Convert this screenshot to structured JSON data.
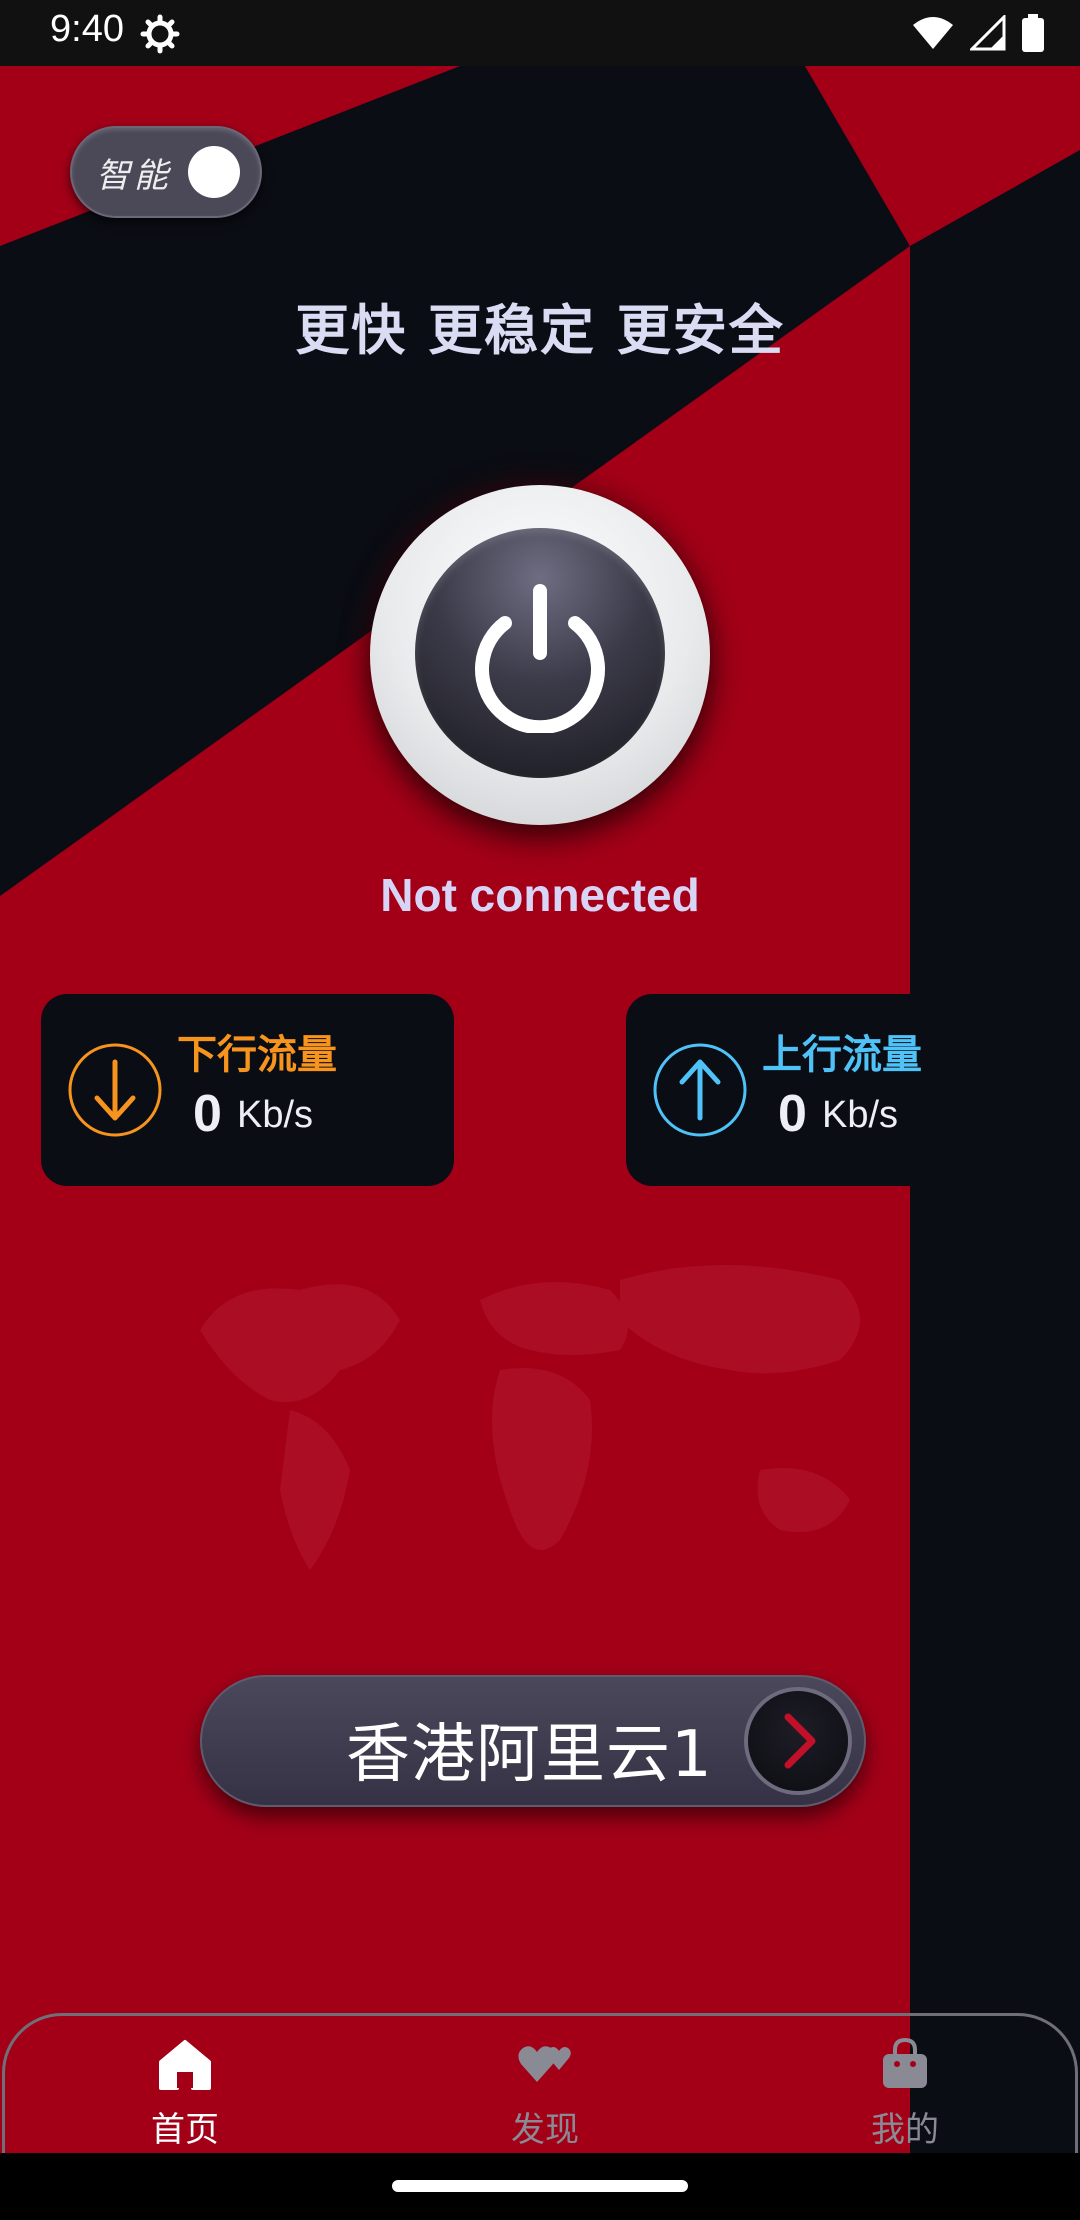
{
  "status_bar": {
    "time": "9:40",
    "icons": [
      "gear-icon",
      "wifi-icon",
      "signal-icon",
      "battery-icon"
    ]
  },
  "smart_toggle": {
    "label": "智能",
    "state": "on"
  },
  "header": {
    "slogan": "更快 更稳定 更安全"
  },
  "connection": {
    "status": "Not connected",
    "icon": "power-icon"
  },
  "traffic": {
    "download": {
      "title": "下行流量",
      "value": "0",
      "unit": "Kb/s",
      "color": "#f7941d",
      "icon": "arrow-down-icon"
    },
    "upload": {
      "title": "上行流量",
      "value": "0",
      "unit": "Kb/s",
      "color": "#4fc3f7",
      "icon": "arrow-up-icon"
    }
  },
  "server": {
    "name": "香港阿里云1",
    "icon": "chevron-right-icon"
  },
  "bottom_nav": {
    "items": [
      {
        "label": "首页",
        "icon": "home-icon",
        "active": true
      },
      {
        "label": "发现",
        "icon": "hearts-icon",
        "active": false
      },
      {
        "label": "我的",
        "icon": "bag-icon",
        "active": false
      }
    ]
  },
  "colors": {
    "primary_red": "#a30018",
    "dark": "#0b0d14",
    "nav_active": "#ffffff",
    "nav_inactive": "#8a8a95"
  }
}
